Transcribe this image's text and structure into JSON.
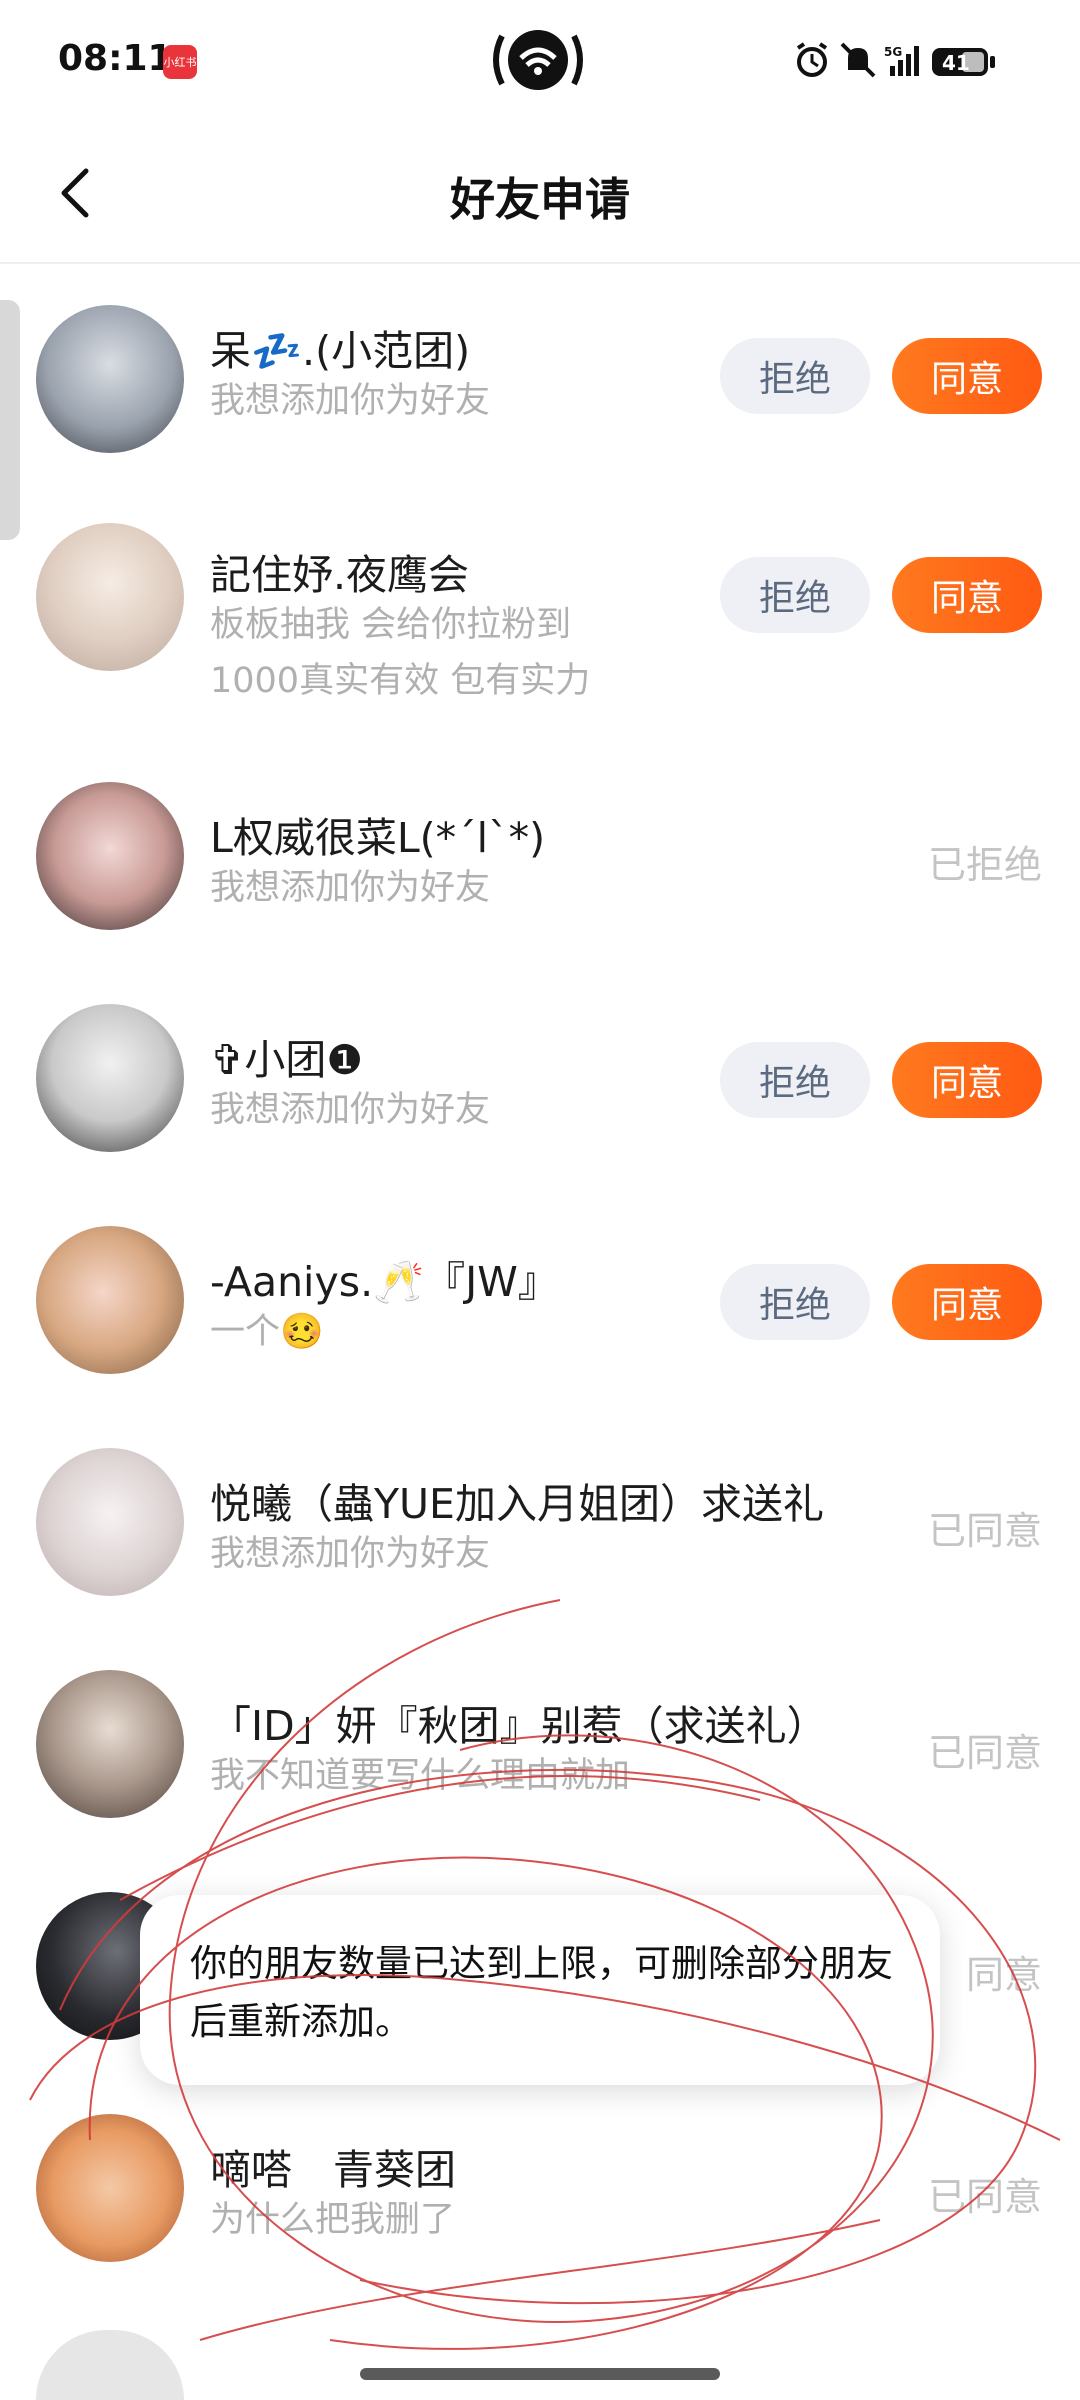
{
  "status_bar": {
    "time": "08:11",
    "app_badge": "小红书",
    "network": "5G",
    "battery": "41"
  },
  "header": {
    "back_icon": "chevron-left-icon",
    "title": "好友申请"
  },
  "buttons": {
    "reject": "拒绝",
    "agree": "同意"
  },
  "requests": [
    {
      "name": "呆💤.(小范团)",
      "message": "我想添加你为好友",
      "state": "pending"
    },
    {
      "name": "記住妤.夜鹰会",
      "message_lines": [
        "板板抽我 会给你拉粉到",
        "1000真实有效 包有实力"
      ],
      "state": "pending"
    },
    {
      "name": "L权威很菜L(*ˊlˋ*)",
      "message": "我想添加你为好友",
      "state": "rejected",
      "state_label": "已拒绝"
    },
    {
      "name": "✞小团❶",
      "message": "我想添加你为好友",
      "state": "pending"
    },
    {
      "name": "-Aaniys.🥂『JW』",
      "message": "一个🥴",
      "state": "pending"
    },
    {
      "name": "悦曦（蟲YUE加入月姐团）求送礼",
      "message": "我想添加你为好友",
      "state": "accepted",
      "state_label": "已同意"
    },
    {
      "name": "「ID」妍『秋团』别惹（求送礼）",
      "message": "我不知道要写什么理由就加",
      "state": "accepted",
      "state_label": "已同意"
    },
    {
      "name": "",
      "message": "",
      "state": "accepted",
      "state_label": "同意"
    },
    {
      "name": "嘀嗒　青葵团",
      "message": "为什么把我删了",
      "state": "accepted",
      "state_label": "已同意"
    }
  ],
  "toast": {
    "text": "你的朋友数量已达到上限，可删除部分朋友后重新添加。"
  }
}
